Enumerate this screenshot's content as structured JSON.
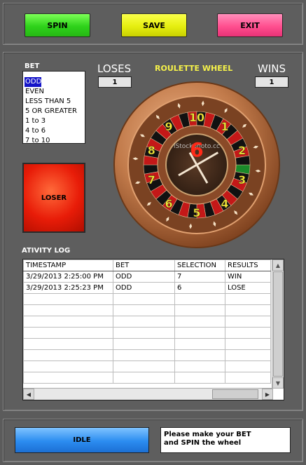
{
  "toolbar": {
    "spin_label": "SPIN",
    "save_label": "SAVE",
    "exit_label": "EXIT"
  },
  "bet": {
    "label": "BET",
    "options": [
      "ODD",
      "EVEN",
      "LESS THAN 5",
      "5 OR GREATER",
      "1 to 3",
      "4 to 6",
      "7 to 10"
    ],
    "selected": "ODD"
  },
  "score": {
    "loses_label": "LOSES",
    "loses_value": "1",
    "wins_label": "WINS",
    "wins_value": "1"
  },
  "wheel": {
    "title": "ROULETTE WHEEL",
    "numbers": [
      "1",
      "2",
      "3",
      "4",
      "5",
      "6",
      "7",
      "8",
      "9",
      "10"
    ],
    "result": "6",
    "watermark": "iStockphoto.cc",
    "colors": {
      "number_yellow": "#f2ec3a",
      "result_red": "#ff2a18",
      "bronze": "#b86a3c"
    }
  },
  "result_light": {
    "label": "LOSER",
    "color": "#e81c08"
  },
  "log": {
    "label": "ATIVITY LOG",
    "columns": [
      "TIMESTAMP",
      "BET",
      "SELECTION",
      "RESULTS"
    ],
    "rows": [
      [
        "3/29/2013 2:25:00 PM",
        "ODD",
        "7",
        "WIN"
      ],
      [
        "3/29/2013 2:25:23 PM",
        "ODD",
        "6",
        "LOSE"
      ]
    ]
  },
  "status": {
    "state_label": "IDLE",
    "message_line1": "Please make your BET",
    "message_line2": "and SPIN the wheel"
  },
  "icons": {
    "scroll_up": "triangle-up-icon",
    "scroll_down": "triangle-down-icon",
    "scroll_left": "triangle-left-icon",
    "scroll_right": "triangle-right-icon"
  }
}
